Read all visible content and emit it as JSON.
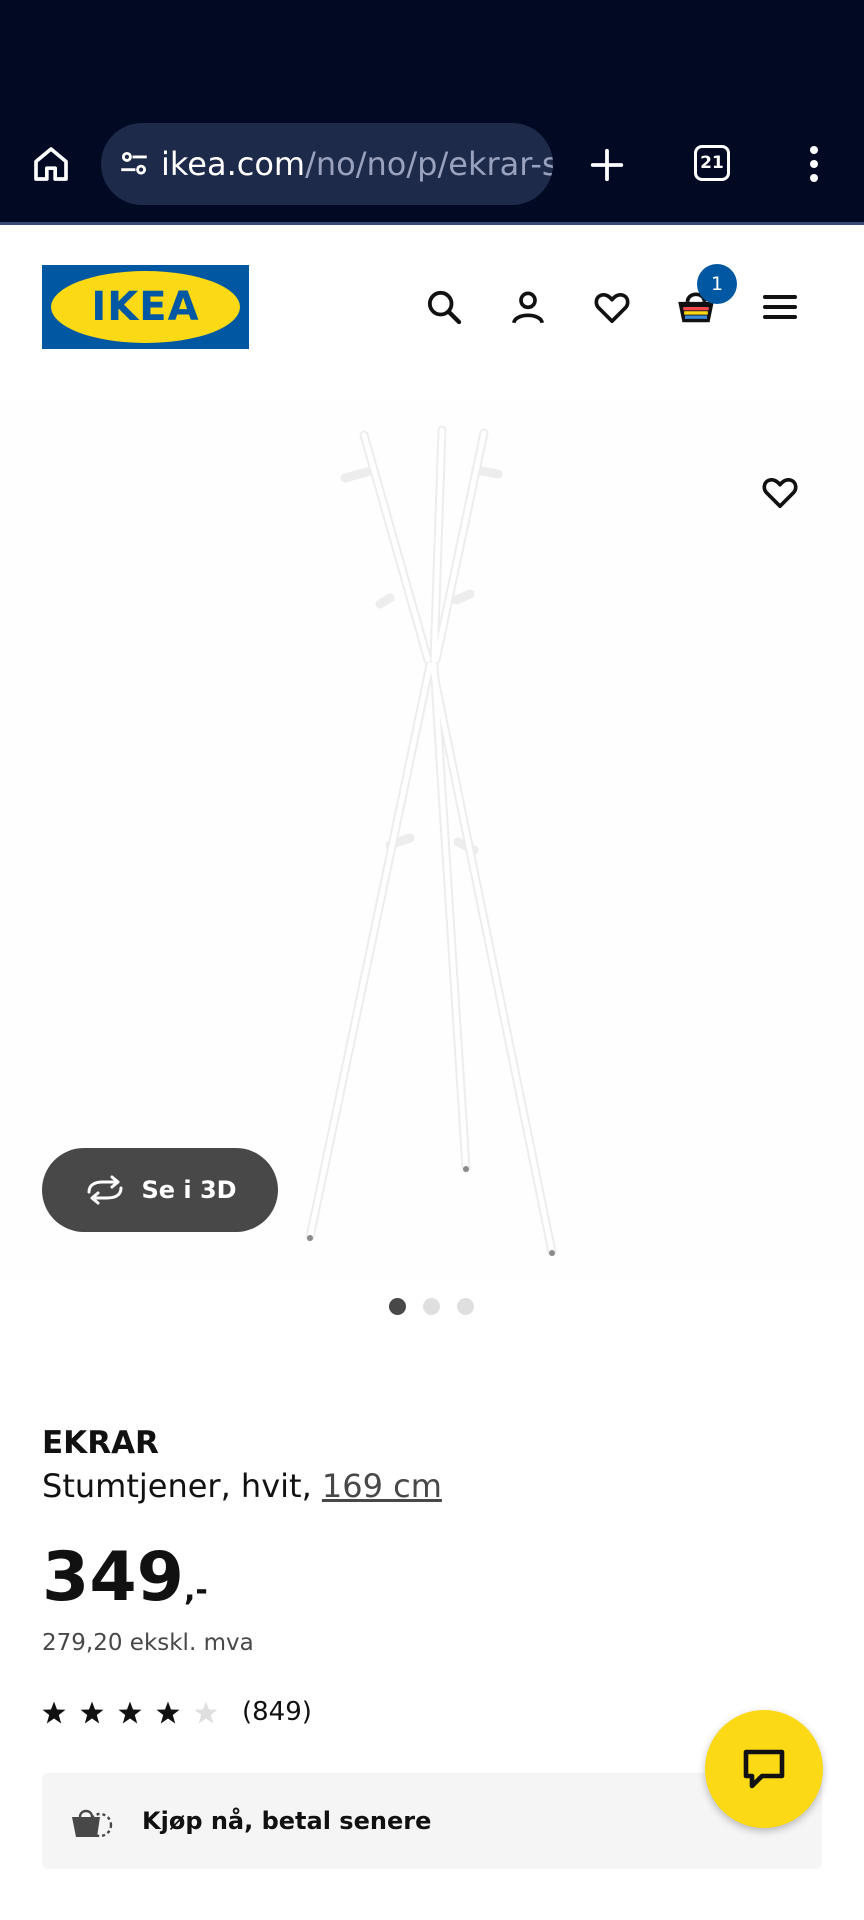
{
  "browser": {
    "url_host": "ikea.com",
    "url_path": "/no/no/p/ekrar-s",
    "tab_count": "21"
  },
  "header": {
    "logo_text": "IKEA",
    "cart_count": "1"
  },
  "gallery": {
    "view_3d_label": "Se i 3D",
    "active_index": 0,
    "total_images": 3
  },
  "product": {
    "name": "EKRAR",
    "description": "Stumtjener, hvit,",
    "size": "169 cm",
    "price_integer": "349",
    "price_decimal": ",-",
    "price_ex_vat": "279,20 ekskl. mva",
    "rating": 4.6,
    "rating_count": "(849)"
  },
  "bnpl": {
    "label": "Kjøp nå, betal senere"
  },
  "colors": {
    "ikea_blue": "#0058a3",
    "ikea_yellow": "#fbd914",
    "browser_bg": "#020a23"
  }
}
